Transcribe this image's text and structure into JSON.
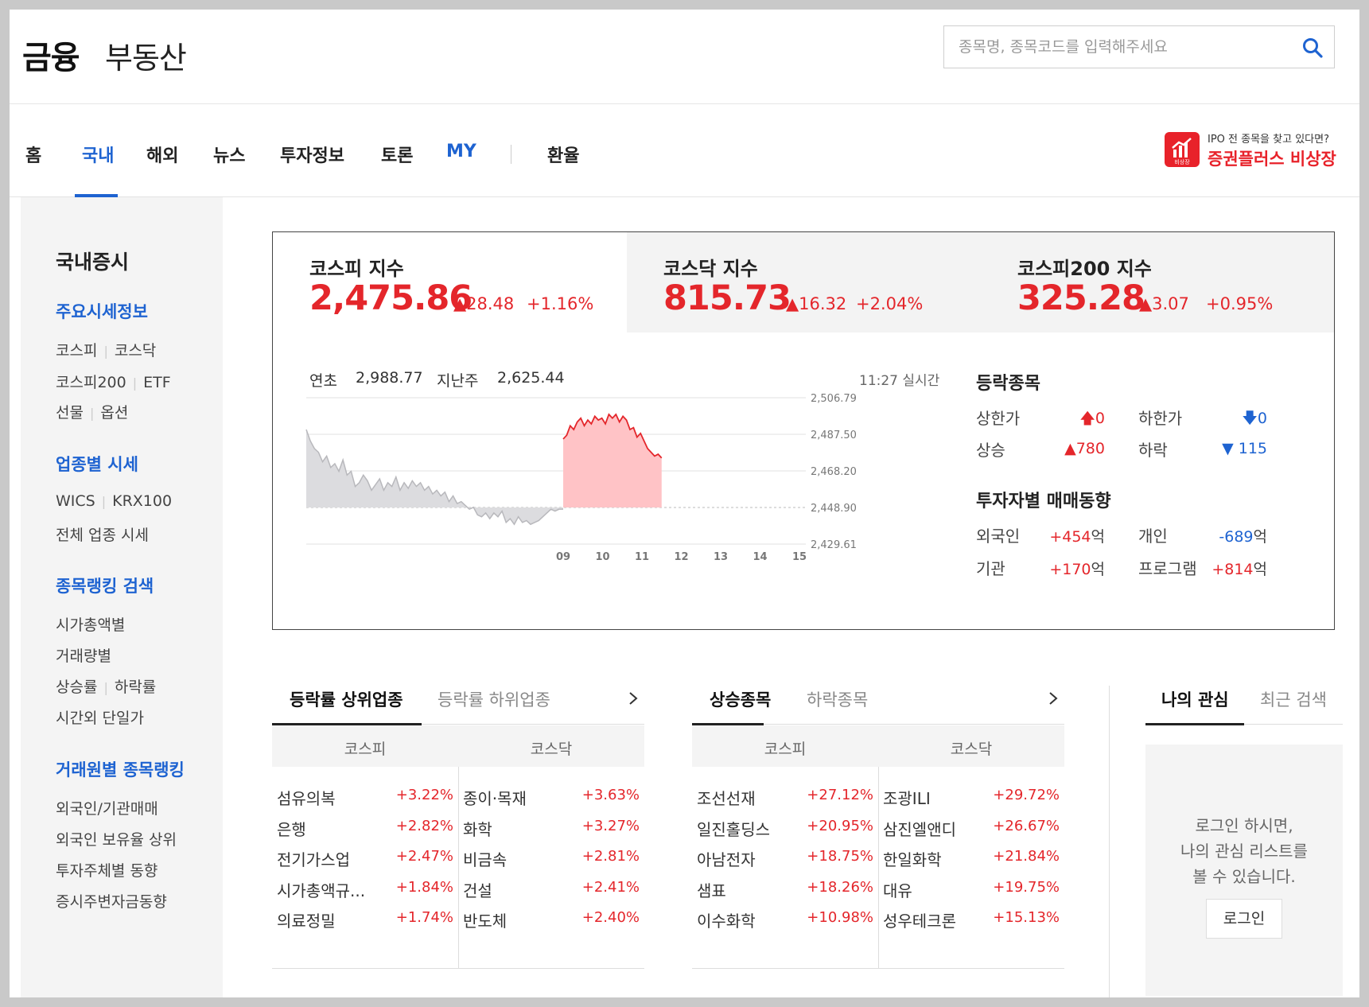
{
  "header": {
    "tab_finance": "금융",
    "tab_realty": "부동산",
    "search_placeholder": "종목명, 종목코드를 입력해주세요"
  },
  "nav": {
    "items": [
      "홈",
      "국내",
      "해외",
      "뉴스",
      "투자정보",
      "토론",
      "MY",
      "환율"
    ],
    "active": "국내",
    "promo_sub": "IPO 전 종목을 찾고 있다면?",
    "promo_main": "증권플러스 비상장",
    "promo_icon_text": "비상장"
  },
  "sidebar": {
    "title": "국내증시",
    "sections": [
      {
        "title": "주요시세정보",
        "links": [
          [
            "코스피",
            "코스닥"
          ],
          [
            "코스피200",
            "ETF"
          ],
          [
            "선물",
            "옵션"
          ]
        ]
      },
      {
        "title": "업종별 시세",
        "links": [
          [
            "WICS",
            "KRX100"
          ],
          [
            "전체 업종 시세"
          ]
        ]
      },
      {
        "title": "종목랭킹 검색",
        "links": [
          [
            "시가총액별"
          ],
          [
            "거래량별"
          ],
          [
            "상승률",
            "하락률"
          ],
          [
            "시간외 단일가"
          ]
        ]
      },
      {
        "title": "거래원별 종목랭킹",
        "links": [
          [
            "외국인/기관매매"
          ],
          [
            "외국인 보유율 상위"
          ],
          [
            "투자주체별 동향"
          ],
          [
            "증시주변자금동향"
          ]
        ]
      }
    ]
  },
  "indices": [
    {
      "name": "코스피 지수",
      "value": "2,475.86",
      "change": "▲28.48",
      "rate": "+1.16%"
    },
    {
      "name": "코스닥 지수",
      "value": "815.73",
      "change": "▲16.32",
      "rate": "+2.04%"
    },
    {
      "name": "코스피200 지수",
      "value": "325.28",
      "change": "▲3.07",
      "rate": "+0.95%"
    }
  ],
  "chart_meta": {
    "year_start_label": "연초",
    "year_start_value": "2,988.77",
    "last_week_label": "지난주",
    "last_week_value": "2,625.44",
    "time": "11:27 실시간"
  },
  "chart_data": {
    "type": "area",
    "y_ticks": [
      "2,506.79",
      "2,487.50",
      "2,468.20",
      "2,448.90",
      "2,429.61"
    ],
    "y_tick_values": [
      2506.79,
      2487.5,
      2468.2,
      2448.9,
      2429.61
    ],
    "x_ticks": [
      "09",
      "10",
      "11",
      "12",
      "13",
      "14",
      "15"
    ],
    "baseline": 2448.9,
    "prev_session": [
      2490,
      2484,
      2480,
      2478,
      2473,
      2476,
      2470,
      2472,
      2468,
      2474,
      2466,
      2468,
      2460,
      2462,
      2466,
      2463,
      2458,
      2461,
      2464,
      2458,
      2462,
      2460,
      2465,
      2458,
      2462,
      2459,
      2463,
      2460,
      2462,
      2458,
      2460,
      2456,
      2458,
      2455,
      2457,
      2452,
      2455,
      2451,
      2452,
      2450,
      2448,
      2449,
      2445,
      2444,
      2446,
      2443,
      2446,
      2444,
      2447,
      2441,
      2443,
      2440,
      2444,
      2441,
      2442,
      2440,
      2441,
      2442,
      2444,
      2446,
      2448,
      2447,
      2448,
      2448
    ],
    "today": [
      2485,
      2487,
      2492,
      2490,
      2494,
      2496,
      2492,
      2495,
      2493,
      2497,
      2495,
      2496,
      2493,
      2498,
      2496,
      2498,
      2494,
      2497,
      2495,
      2490,
      2491,
      2486,
      2488,
      2484,
      2480,
      2478,
      2476,
      2477,
      2475
    ],
    "grid": true
  },
  "updown": {
    "title": "등락종목",
    "upper_limit_label": "상한가",
    "upper_limit_value": "0",
    "lower_limit_label": "하한가",
    "lower_limit_value": "0",
    "rise_label": "상승",
    "rise_value": "▲780",
    "fall_label": "하락",
    "fall_value": "▼ 115"
  },
  "investor": {
    "title": "투자자별 매매동향",
    "foreign_label": "외국인",
    "foreign_value": "+454",
    "individual_label": "개인",
    "individual_value": "-689",
    "institution_label": "기관",
    "institution_value": "+170",
    "program_label": "프로그램",
    "program_value": "+814",
    "unit": "억"
  },
  "sector_rank": {
    "tab_on": "등락률 상위업종",
    "tab_off": "등락률 하위업종",
    "col1": "코스피",
    "col2": "코스닥",
    "kospi": [
      [
        "섬유의복",
        "+3.22%"
      ],
      [
        "은행",
        "+2.82%"
      ],
      [
        "전기가스업",
        "+2.47%"
      ],
      [
        "시가총액규...",
        "+1.84%"
      ],
      [
        "의료정밀",
        "+1.74%"
      ]
    ],
    "kosdaq": [
      [
        "종이·목재",
        "+3.63%"
      ],
      [
        "화학",
        "+3.27%"
      ],
      [
        "비금속",
        "+2.81%"
      ],
      [
        "건설",
        "+2.41%"
      ],
      [
        "반도체",
        "+2.40%"
      ]
    ]
  },
  "stock_rank": {
    "tab_on": "상승종목",
    "tab_off": "하락종목",
    "col1": "코스피",
    "col2": "코스닥",
    "kospi": [
      [
        "조선선재",
        "+27.12%"
      ],
      [
        "일진홀딩스",
        "+20.95%"
      ],
      [
        "아남전자",
        "+18.75%"
      ],
      [
        "샘표",
        "+18.26%"
      ],
      [
        "이수화학",
        "+10.98%"
      ]
    ],
    "kosdaq": [
      [
        "조광ILI",
        "+29.72%"
      ],
      [
        "삼진엘앤디",
        "+26.67%"
      ],
      [
        "한일화학",
        "+21.84%"
      ],
      [
        "대유",
        "+19.75%"
      ],
      [
        "성우테크론",
        "+15.13%"
      ]
    ]
  },
  "my": {
    "tab_on": "나의 관심",
    "tab_off": "최근 검색",
    "message_1": "로그인 하시면,",
    "message_2": "나의 관심 리스트를",
    "message_3": "볼 수 있습니다.",
    "login_button": "로그인"
  }
}
